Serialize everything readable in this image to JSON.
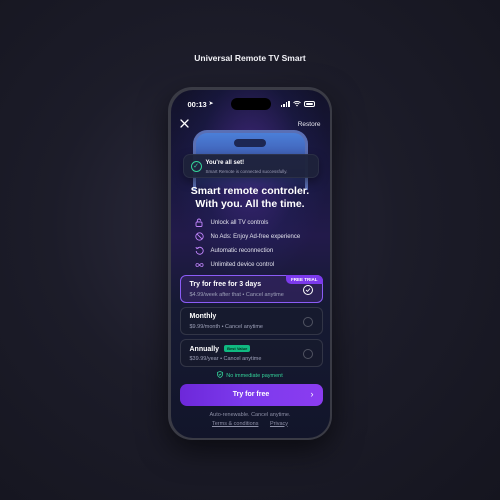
{
  "page": {
    "title": "Universal Remote TV Smart"
  },
  "status_bar": {
    "time": "00:13"
  },
  "header": {
    "restore_label": "Restore"
  },
  "toast": {
    "title": "You're all set!",
    "subtitle": "Smart Remote is connected successfully."
  },
  "headline": {
    "line1": "Smart remote controler.",
    "line2": "With you. All the time."
  },
  "features": [
    {
      "label": "Unlock all TV controls",
      "icon": "lock-icon"
    },
    {
      "label": "No Ads: Enjoy Ad-free experience",
      "icon": "no-ads-icon"
    },
    {
      "label": "Automatic reconnection",
      "icon": "refresh-icon"
    },
    {
      "label": "Unlimited device control",
      "icon": "infinity-icon"
    }
  ],
  "plans": [
    {
      "name": "Try for free for 3 days",
      "subtitle": "$4.99/week after that • Cancel anytime",
      "badge": "FREE TRIAL",
      "selected": true
    },
    {
      "name": "Monthly",
      "subtitle": "$9.99/month • Cancel anytime",
      "selected": false
    },
    {
      "name": "Annually",
      "subtitle": "$39.99/year • Cancel anytime",
      "badge": "Best Value",
      "selected": false
    }
  ],
  "no_payment_label": "No immediate payment",
  "cta": {
    "label": "Try for free"
  },
  "footer": {
    "auto_renew": "Auto-renewable. Cancel anytime.",
    "terms": "Terms & conditions",
    "privacy": "Privacy"
  },
  "colors": {
    "accent": "#7c3aed",
    "success": "#34d399",
    "feature_icon": "#c084fc"
  }
}
